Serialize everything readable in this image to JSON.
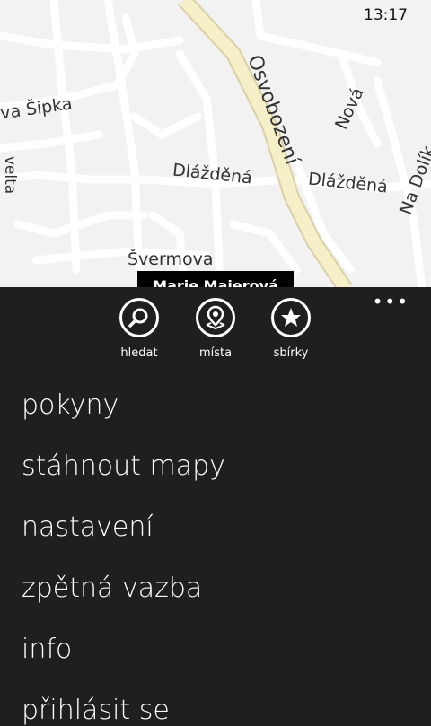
{
  "status_bar": {
    "time": "13:17"
  },
  "map": {
    "streets": {
      "osvobozeni": "Osvobození",
      "sipka": "va Šipka",
      "dlazdena_left": "Dlážděná",
      "dlazdena_right": "Dlážděná",
      "nova": "Nová",
      "na_dolik": "Na Dolík",
      "svermova": "Švermova",
      "vertical_left": "velta"
    },
    "pin_label": "Marie Majerová"
  },
  "appbar": {
    "buttons": [
      {
        "label": "hledat",
        "icon": "search-icon"
      },
      {
        "label": "místa",
        "icon": "places-pin-icon"
      },
      {
        "label": "sbírky",
        "icon": "star-icon"
      }
    ],
    "more": "•••"
  },
  "menu": [
    "pokyny",
    "stáhnout mapy",
    "nastavení",
    "zpětná vazba",
    "info",
    "přihlásit se"
  ],
  "colors": {
    "map_bg": "#f2f2f2",
    "major_road": "#f5f0c8",
    "appbar_bg": "#1f1f1f",
    "text_light": "#ffffff"
  }
}
